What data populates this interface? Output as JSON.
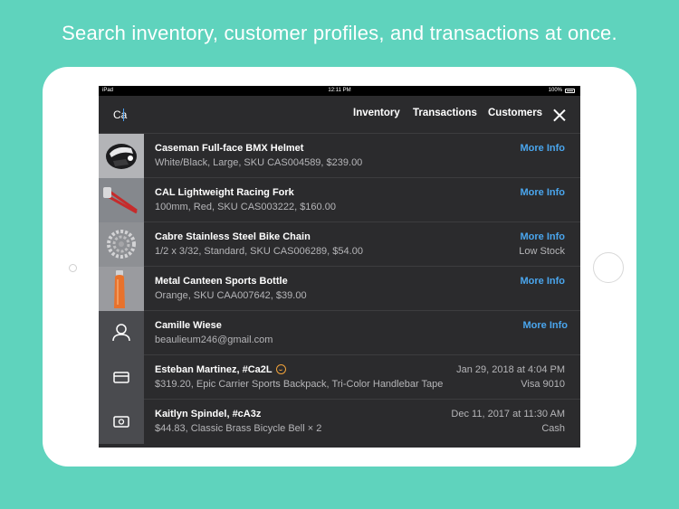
{
  "headline": "Search inventory, customer profiles, and transactions at once.",
  "status": {
    "left": "iPad",
    "time": "12:11 PM",
    "right": "100%"
  },
  "search": {
    "value": "Ca"
  },
  "tabs": [
    "Inventory",
    "Transactions",
    "Customers"
  ],
  "colors": {
    "background": "#5fd3bd",
    "accent": "#4aa6ee",
    "badge": "#f0a23a"
  },
  "rows": [
    {
      "type": "item",
      "icon": "helmet-photo",
      "title": "Caseman Full-face BMX Helmet",
      "subtitle": "White/Black, Large, SKU CAS004589, $239.00",
      "action": "More Info"
    },
    {
      "type": "item",
      "icon": "fork-photo",
      "title": "CAL Lightweight Racing Fork",
      "subtitle": "100mm, Red, SKU CAS003222, $160.00",
      "action": "More Info"
    },
    {
      "type": "item",
      "icon": "chain-photo",
      "title": "Cabre Stainless Steel Bike Chain",
      "subtitle": "1/2 x 3/32, Standard, SKU CAS006289, $54.00",
      "action": "More Info",
      "note": "Low Stock"
    },
    {
      "type": "item",
      "icon": "bottle-photo",
      "title": "Metal Canteen Sports Bottle",
      "subtitle": "Orange, SKU CAA007642, $39.00",
      "action": "More Info"
    },
    {
      "type": "customer",
      "icon": "person-icon",
      "title": "Camille Wiese",
      "subtitle": "beaulieum246@gmail.com",
      "action": "More Info"
    },
    {
      "type": "transaction",
      "icon": "card-icon",
      "title": "Esteban Martinez, #Ca2L",
      "subtitle": "$319.20, Epic Carrier Sports Backpack, Tri-Color Handlebar Tape",
      "date": "Jan 29, 2018 at 4:04 PM",
      "method": "Visa 9010"
    },
    {
      "type": "transaction",
      "icon": "cash-icon",
      "title": "Kaitlyn Spindel, #cA3z",
      "subtitle": "$44.83, Classic Brass Bicycle Bell × 2",
      "date": "Dec 11, 2017 at 11:30 AM",
      "method": "Cash"
    }
  ]
}
